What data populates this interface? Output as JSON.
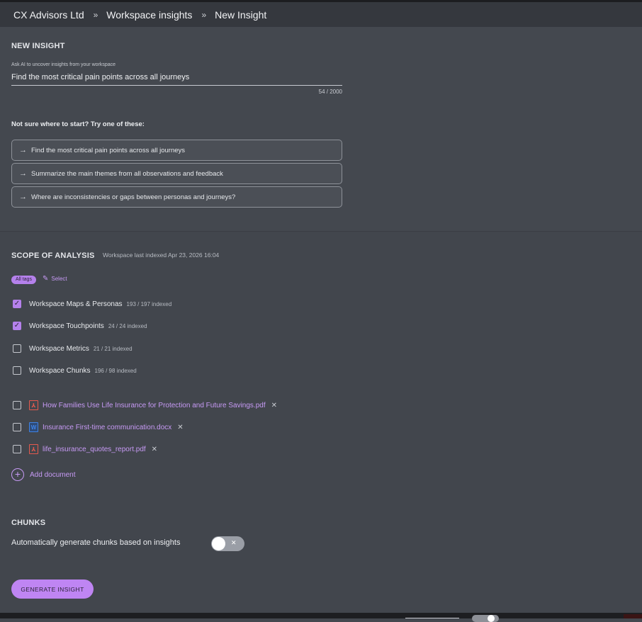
{
  "breadcrumb": {
    "items": [
      "CX Advisors Ltd",
      "Workspace insights",
      "New Insight"
    ],
    "separator": "»"
  },
  "new_insight": {
    "title": "NEW INSIGHT",
    "ask_label": "Ask AI to uncover insights from your workspace",
    "question_value": "Find the most critical pain points across all journeys",
    "counter": "54 / 2000",
    "hint_title": "Not sure where to start? Try one of these:",
    "suggestions": [
      "Find the most critical pain points across all journeys",
      "Summarize the main themes from all observations and feedback",
      "Where are inconsistencies or gaps between personas and journeys?"
    ]
  },
  "scope": {
    "title": "SCOPE OF ANALYSIS",
    "indexed_note": "Workspace last indexed Apr 23, 2026 16:04",
    "tag_chip": "All tags",
    "select_label": "Select",
    "sources": [
      {
        "label": "Workspace Maps & Personas",
        "meta": "193 / 197 indexed",
        "checked": true
      },
      {
        "label": "Workspace Touchpoints",
        "meta": "24 / 24 indexed",
        "checked": true
      },
      {
        "label": "Workspace Metrics",
        "meta": "21 / 21 indexed",
        "checked": false
      },
      {
        "label": "Workspace Chunks",
        "meta": "196 / 98 indexed",
        "checked": false
      }
    ],
    "documents": [
      {
        "name": "How Families Use Life Insurance for Protection and Future Savings.pdf",
        "type": "pdf",
        "icon": "pdf-file-icon",
        "checked": false
      },
      {
        "name": "Insurance First-time communication.docx",
        "type": "docx",
        "icon": "word-file-icon",
        "checked": false
      },
      {
        "name": "life_insurance_quotes_report.pdf",
        "type": "pdf",
        "icon": "pdf-file-icon",
        "checked": false
      }
    ],
    "add_document": "Add document"
  },
  "chunks": {
    "title": "CHUNKS",
    "auto_label": "Automatically generate chunks based on insights",
    "auto_enabled": false
  },
  "actions": {
    "generate_label": "GENERATE INSIGHT"
  },
  "colors": {
    "accent": "#bf85f3",
    "background": "#44484f",
    "topbar": "#35383e",
    "pdf": "#e55a4e",
    "docx": "#3f83e6"
  }
}
